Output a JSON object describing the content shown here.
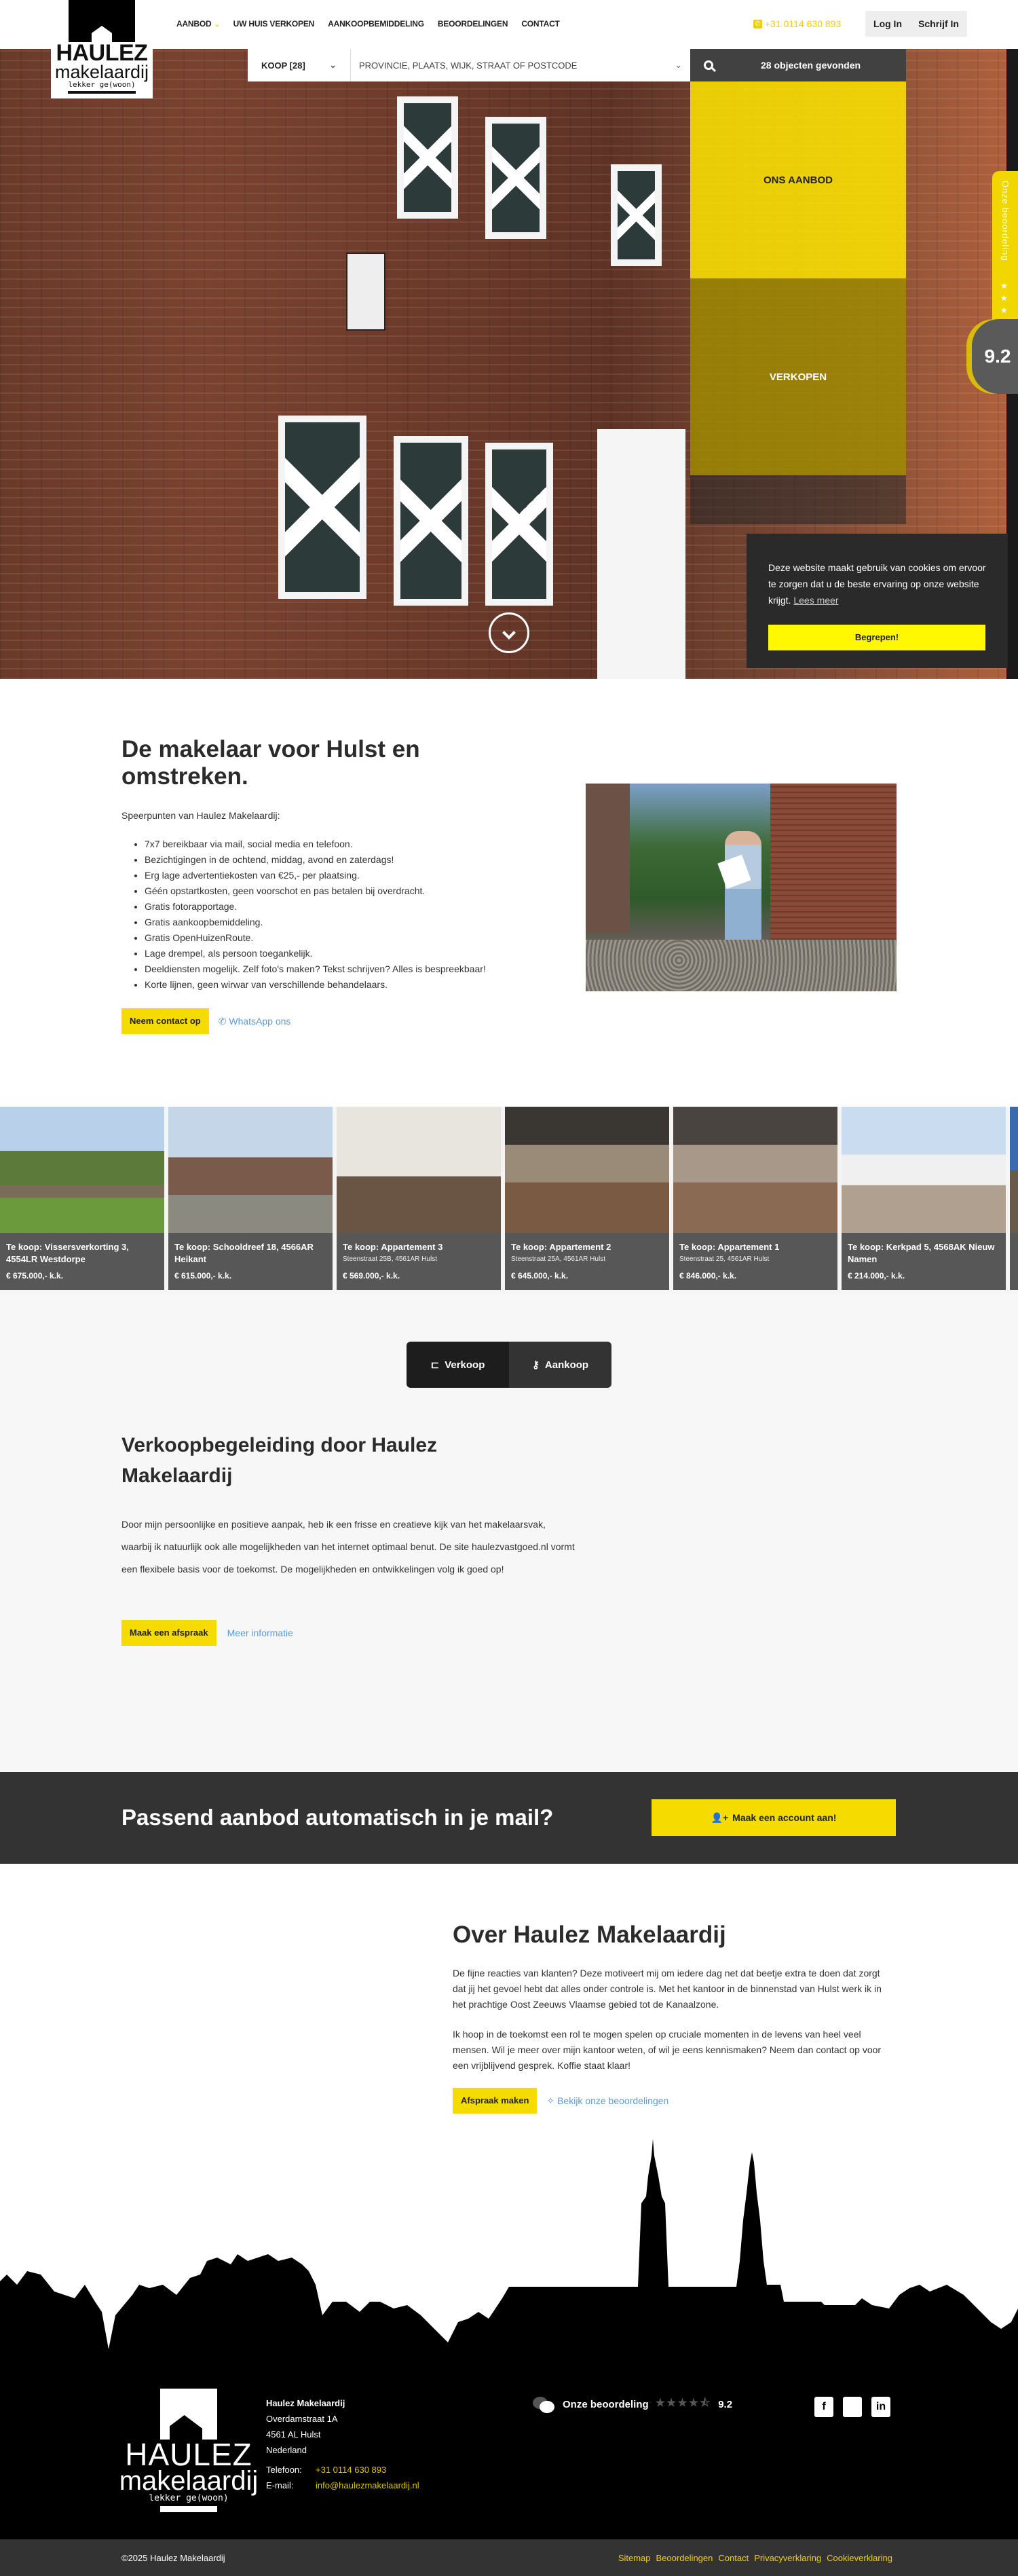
{
  "brand": {
    "name_line1": "HAULEZ",
    "name_line2": "makelaardij",
    "tagline": "lekker ge(woon)"
  },
  "nav": {
    "items": [
      {
        "label": "AANBOD",
        "has_dropdown": true
      },
      {
        "label": "UW HUIS VERKOPEN"
      },
      {
        "label": "AANKOOPBEMIDDELING"
      },
      {
        "label": "BEOORDELINGEN"
      },
      {
        "label": "CONTACT"
      }
    ],
    "phone": "+31 0114 630 893",
    "login": "Log In",
    "signup": "Schrijf In"
  },
  "search": {
    "type_value": "KOOP [28]",
    "location_placeholder": "PROVINCIE, PLAATS, WIJK, STRAAT OF POSTCODE",
    "result_label": "28 objecten gevonden"
  },
  "hero": {
    "tile_aanbod": "ONS AANBOD",
    "tile_verkopen": "VERKOPEN"
  },
  "rating_widget": {
    "label": "Onze beoordeling",
    "score": "9.2",
    "stars": 4.5
  },
  "cookie": {
    "text": "Deze website maakt gebruik van cookies om ervoor te zorgen dat u de beste ervaring op onze website krijgt.",
    "more": "Lees meer",
    "accept": "Begrepen!"
  },
  "intro": {
    "title": "De makelaar voor Hulst en omstreken.",
    "lead": "Speerpunten van Haulez Makelaardij:",
    "bullets": [
      "7x7 bereikbaar via mail, social media en telefoon.",
      "Bezichtigingen in de ochtend, middag, avond en zaterdags!",
      "Erg lage advertentiekosten van €25,- per plaatsing.",
      "Géén opstartkosten, geen voorschot en pas betalen bij overdracht.",
      "Gratis fotorapportage.",
      "Gratis aankoopbemiddeling.",
      "Gratis OpenHuizenRoute.",
      "Lage drempel, als persoon toegankelijk.",
      "Deeldiensten mogelijk. Zelf foto's maken? Tekst schrijven? Alles is bespreekbaar!",
      "Korte lijnen, geen wirwar van verschillende behandelaars."
    ],
    "contact_button": "Neem contact op",
    "whatsapp_link": "WhatsApp ons"
  },
  "listings": [
    {
      "title": "Te koop: Vissersverkorting 3, 4554LR Westdorpe",
      "address": "",
      "price": "€ 675.000,- k.k."
    },
    {
      "title": "Te koop: Schooldreef 18, 4566AR Heikant",
      "address": "",
      "price": "€ 615.000,- k.k."
    },
    {
      "title": "Te koop: Appartement 3",
      "address": "Steenstraat 25B, 4561AR Hulst",
      "price": "€ 569.000,- k.k."
    },
    {
      "title": "Te koop: Appartement 2",
      "address": "Steenstraat 25A, 4561AR Hulst",
      "price": "€ 645.000,- k.k."
    },
    {
      "title": "Te koop: Appartement 1",
      "address": "Steenstraat 25, 4561AR Hulst",
      "price": "€ 846.000,- k.k."
    },
    {
      "title": "Te koop: Kerkpad 5, 4568AK Nieuw Namen",
      "address": "",
      "price": "€ 214.000,- k.k."
    }
  ],
  "verkoop": {
    "tabs": [
      {
        "label": "Verkoop",
        "active": true
      },
      {
        "label": "Aankoop",
        "active": false
      }
    ],
    "title": "Verkoopbegeleiding door Haulez Makelaardij",
    "body": "Door mijn persoonlijke en positieve aanpak, heb ik een frisse en creatieve kijk van het makelaarsvak, waarbij ik natuurlijk ook alle mogelijkheden van het internet optimaal benut. De site haulezvastgoed.nl vormt een flexibele basis voor de toekomst. De mogelijkheden en ontwikkelingen volg ik goed op!",
    "appointment_button": "Maak een afspraak",
    "more_link": "Meer informatie"
  },
  "band": {
    "title": "Passend aanbod automatisch in je mail?",
    "button": "Maak een account aan!"
  },
  "about": {
    "title": "Over Haulez Makelaardij",
    "p1": "De fijne reacties van klanten? Deze motiveert mij om iedere dag net dat beetje extra te doen dat zorgt dat jij het gevoel hebt dat alles onder controle is. Met het kantoor in de binnenstad van Hulst werk ik in het prachtige Oost Zeeuws Vlaamse gebied tot de Kanaalzone.",
    "p2": "Ik hoop in de toekomst een rol te mogen spelen op cruciale momenten in de levens van heel veel mensen. Wil je meer over mijn kantoor weten, of wil je eens kennismaken? Neem dan contact op voor een vrijblijvend gesprek. Koffie staat klaar!",
    "button": "Afspraak maken",
    "reviews_link": "Bekijk onze beoordelingen"
  },
  "footer": {
    "company": "Haulez Makelaardij",
    "street": "Overdamstraat 1A",
    "city": "4561 AL Hulst",
    "country": "Nederland",
    "phone_label": "Telefoon:",
    "phone": "+31 0114 630 893",
    "email_label": "E-mail:",
    "email": "info@haulezmakelaardij.nl",
    "rating_label": "Onze beoordeling",
    "rating_score": "9.2",
    "social": [
      "facebook",
      "twitter",
      "linkedin"
    ],
    "copyright": "©2025 Haulez Makelaardij",
    "links": [
      "Sitemap",
      "Beoordelingen",
      "Contact",
      "Privacyverklaring",
      "Cookieverklaring"
    ]
  },
  "colors": {
    "accent_yellow": "#f5db00",
    "dark": "#333333",
    "link_blue": "#5b9bd5"
  }
}
